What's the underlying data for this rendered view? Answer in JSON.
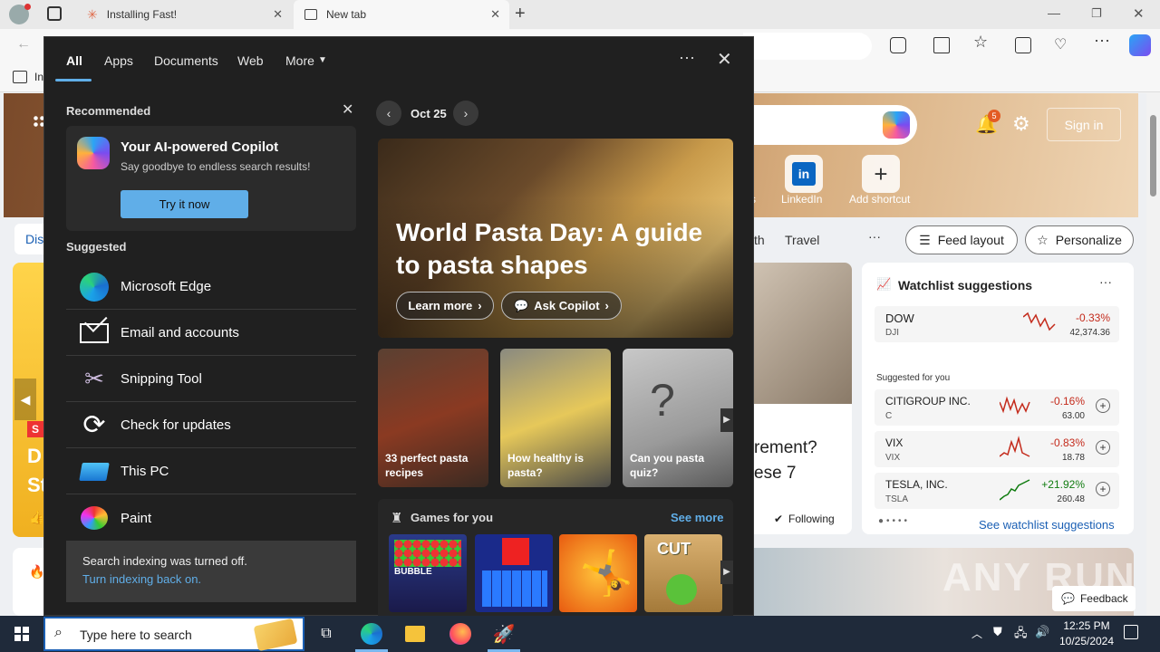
{
  "browser": {
    "tabs": [
      {
        "title": "Installing Fast!"
      },
      {
        "title": "New tab"
      }
    ],
    "bookmark_partial": "In"
  },
  "newtab": {
    "notification_count": "5",
    "sign_in": "Sign in",
    "shortcuts": [
      {
        "label": "LinkedIn"
      },
      {
        "label": "Add shortcut"
      }
    ],
    "partial_label_left": "s",
    "nav_partial": "th",
    "nav_travel": "Travel",
    "nav_more": "···",
    "feed_layout": "Feed layout",
    "personalize": "Personalize",
    "left_tab_partial": "Dis",
    "left_badge": "S",
    "left_headline_partial": [
      "D",
      "St"
    ],
    "article_partial": [
      "rement?",
      "ese 7"
    ],
    "following": "Following",
    "watchlist": {
      "title": "Watchlist suggestions",
      "main": {
        "name": "DOW",
        "sub": "DJI",
        "change": "-0.33%",
        "value": "42,374.36"
      },
      "suggested_label": "Suggested for you",
      "items": [
        {
          "name": "CITIGROUP INC.",
          "sub": "C",
          "change": "-0.16%",
          "value": "63.00"
        },
        {
          "name": "VIX",
          "sub": "VIX",
          "change": "-0.83%",
          "value": "18.78"
        },
        {
          "name": "TESLA, INC.",
          "sub": "TSLA",
          "change": "+21.92%",
          "value": "260.48"
        }
      ],
      "see_link": "See watchlist suggestions"
    },
    "feedback": "Feedback",
    "watermark": "ANY RUN"
  },
  "start": {
    "tabs": [
      "All",
      "Apps",
      "Documents",
      "Web",
      "More"
    ],
    "recommended_title": "Recommended",
    "copilot_title": "Your AI-powered Copilot",
    "copilot_sub": "Say goodbye to endless search results!",
    "try_button": "Try it now",
    "suggested_title": "Suggested",
    "suggested": [
      {
        "label": "Microsoft Edge"
      },
      {
        "label": "Email and accounts"
      },
      {
        "label": "Snipping Tool"
      },
      {
        "label": "Check for updates"
      },
      {
        "label": "This PC"
      },
      {
        "label": "Paint"
      }
    ],
    "indexing_msg": "Search indexing was turned off.",
    "indexing_link": "Turn indexing back on.",
    "date": "Oct 25",
    "feature_title": "World Pasta Day: A guide to pasta shapes",
    "learn_more": "Learn more",
    "ask_copilot": "Ask Copilot",
    "tiles": [
      {
        "caption": "33 perfect pasta recipes"
      },
      {
        "caption": "How healthy is pasta?"
      },
      {
        "caption": "Can you pasta quiz?"
      }
    ],
    "games_title": "Games for you",
    "see_more": "See more",
    "games": [
      {
        "name": "BUBBLE SHOOTER HD"
      },
      {
        "name": "Tetris blocks"
      },
      {
        "name": "Stickman fighter"
      },
      {
        "name": "CUT the ROPE"
      }
    ]
  },
  "taskbar": {
    "search_placeholder": "Type here to search",
    "time": "12:25 PM",
    "date": "10/25/2024"
  },
  "colors": {
    "panel_bg": "#202020",
    "accent_blue": "#60aee8",
    "taskbar_bg": "#1f2a3a",
    "negative": "#c42b1c",
    "positive": "#107c10"
  }
}
